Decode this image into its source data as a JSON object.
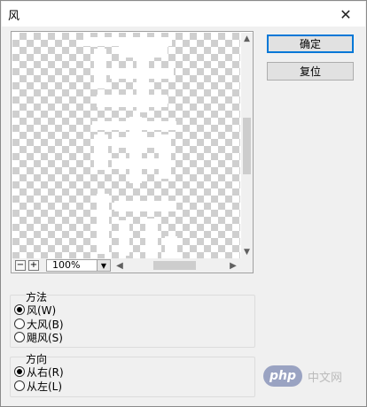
{
  "window": {
    "title": "风",
    "close_glyph": "✕"
  },
  "preview": {
    "zoom_out_glyph": "−",
    "zoom_in_glyph": "+",
    "zoom_value": "100%"
  },
  "buttons": {
    "ok_label": "确定",
    "reset_label": "复位"
  },
  "method": {
    "title": "方法",
    "options": [
      "风(W)",
      "大风(B)",
      "飓风(S)"
    ],
    "selected": "风(W)"
  },
  "direction": {
    "title": "方向",
    "options": [
      "从右(R)",
      "从左(L)"
    ],
    "selected": "从右(R)"
  },
  "watermark": {
    "logo_text": "php",
    "site_text": "中文网"
  },
  "icons": {
    "close": "close-icon",
    "zoom_out": "zoom-out-icon",
    "zoom_in": "zoom-in-icon",
    "dropdown": "chevron-down-icon",
    "scroll_up": "chevron-up-icon",
    "scroll_down": "chevron-down-icon",
    "scroll_left": "chevron-left-icon",
    "scroll_right": "chevron-right-icon"
  },
  "colors": {
    "default_button_border": "#0078d7",
    "dialog_background": "#f0f0f0"
  }
}
